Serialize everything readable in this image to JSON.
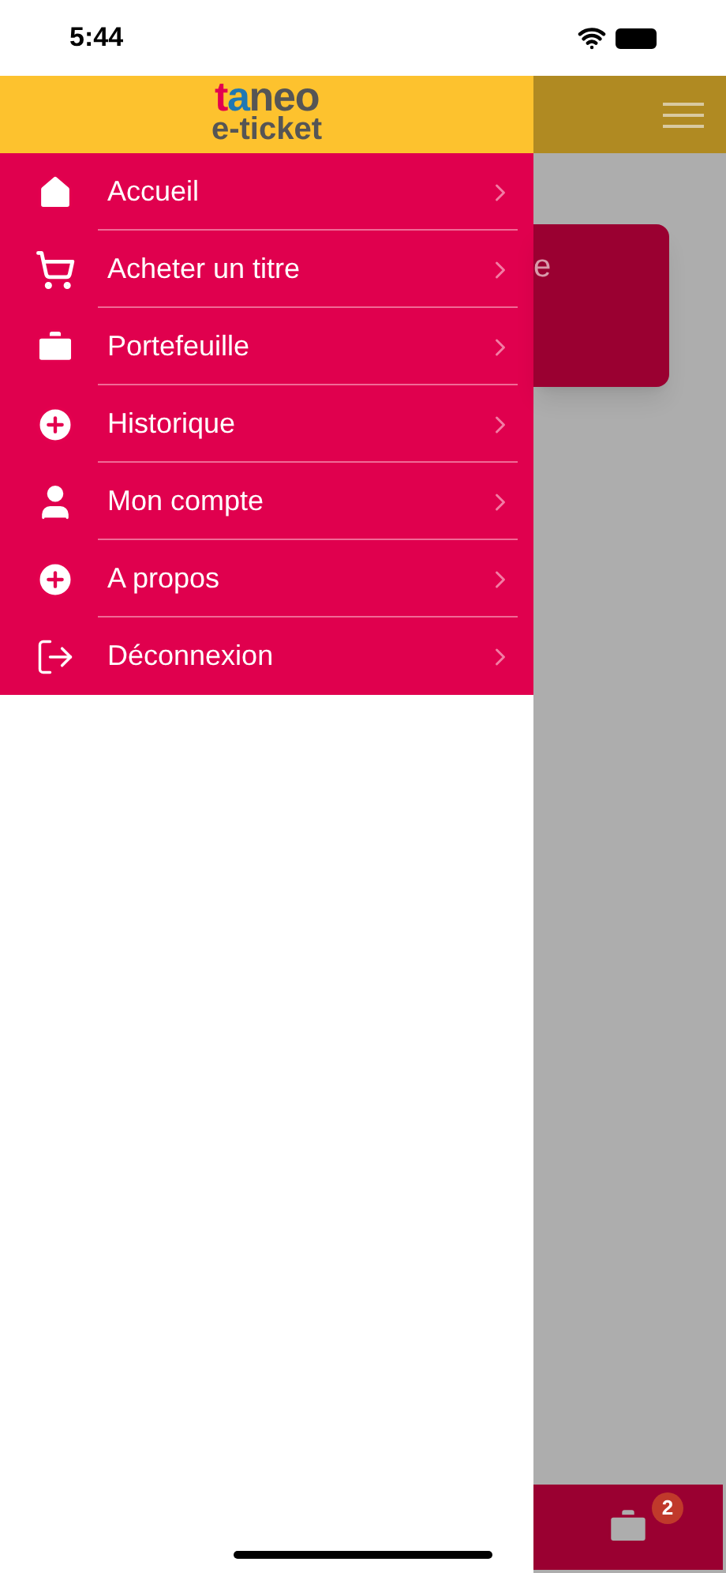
{
  "status_bar": {
    "time": "5:44"
  },
  "header": {
    "logo_word": "taneo",
    "logo_sub": "e-ticket"
  },
  "menu": [
    {
      "label": "Accueil"
    },
    {
      "label": "Acheter un titre"
    },
    {
      "label": "Portefeuille"
    },
    {
      "label": "Historique"
    },
    {
      "label": "Mon compte"
    },
    {
      "label": "A propos"
    },
    {
      "label": "Déconnexion"
    }
  ],
  "background_card": {
    "text": "e"
  },
  "tab_bar": {
    "badge": "2"
  }
}
